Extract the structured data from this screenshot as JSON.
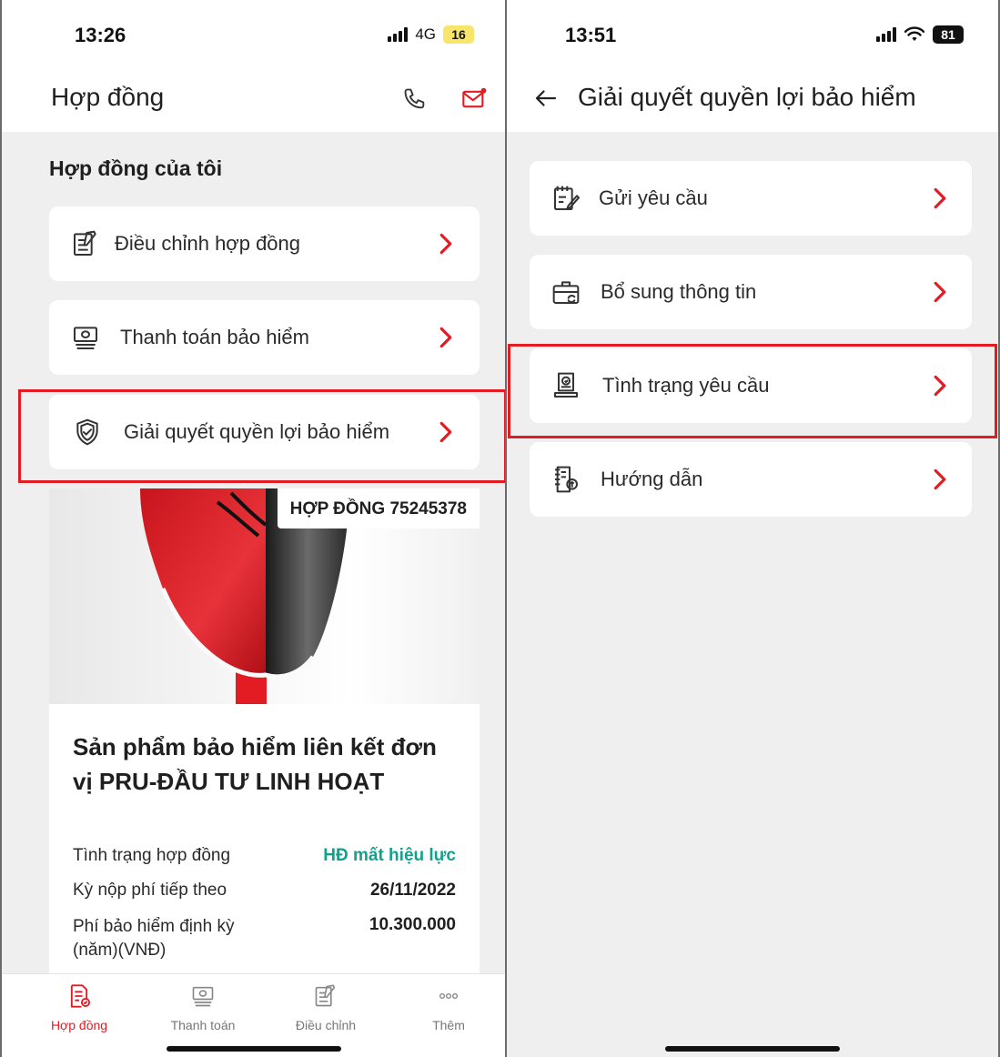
{
  "left": {
    "status": {
      "time": "13:26",
      "network": "4G",
      "battery": "16"
    },
    "header": {
      "title": "Hợp đồng"
    },
    "section_title": "Hợp đồng của tôi",
    "menu": [
      {
        "label": "Điều chỉnh hợp đồng",
        "icon": "edit-document-icon"
      },
      {
        "label": "Thanh toán bảo hiểm",
        "icon": "payment-icon"
      },
      {
        "label": "Giải quyết quyền lợi bảo hiểm",
        "icon": "shield-icon"
      }
    ],
    "contract": {
      "tag": "HỢP ĐỒNG 75245378",
      "product_name": "Sản phẩm bảo hiểm liên kết đơn vị PRU-ĐẦU TƯ LINH HOẠT",
      "rows": [
        {
          "label": "Tình trạng hợp đồng",
          "value": "HĐ mất hiệu lực"
        },
        {
          "label": "Kỳ nộp phí tiếp theo",
          "value": "26/11/2022"
        },
        {
          "label": "Phí bảo hiểm định kỳ (năm)(VNĐ)",
          "value": "10.300.000"
        }
      ]
    },
    "tabs": [
      {
        "label": "Hợp đồng",
        "icon": "contract-icon",
        "active": true
      },
      {
        "label": "Thanh toán",
        "icon": "payment-icon",
        "active": false
      },
      {
        "label": "Điều chỉnh",
        "icon": "edit-icon",
        "active": false
      },
      {
        "label": "Thêm",
        "icon": "more-icon",
        "active": false
      }
    ]
  },
  "right": {
    "status": {
      "time": "13:51",
      "battery": "81"
    },
    "header": {
      "title": "Giải quyết quyền lợi bảo hiểm"
    },
    "menu": [
      {
        "label": "Gửi yêu cầu",
        "icon": "submit-request-icon"
      },
      {
        "label": "Bổ sung thông tin",
        "icon": "briefcase-icon"
      },
      {
        "label": "Tình trạng yêu cầu",
        "icon": "request-status-icon"
      },
      {
        "label": "Hướng dẫn",
        "icon": "guide-icon"
      }
    ]
  },
  "colors": {
    "accent": "#e31b23",
    "status_lapsed": "#15a08d",
    "background": "#efefef"
  }
}
